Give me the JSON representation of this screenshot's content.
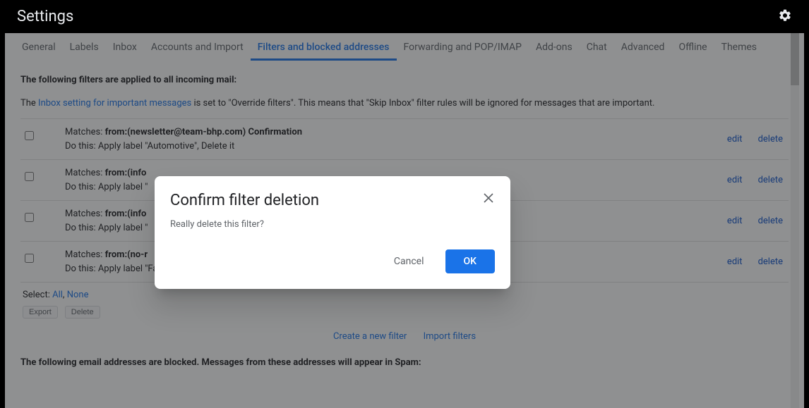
{
  "header": {
    "title": "Settings"
  },
  "tabs": [
    {
      "label": "General",
      "active": false
    },
    {
      "label": "Labels",
      "active": false
    },
    {
      "label": "Inbox",
      "active": false
    },
    {
      "label": "Accounts and Import",
      "active": false
    },
    {
      "label": "Filters and blocked addresses",
      "active": true
    },
    {
      "label": "Forwarding and POP/IMAP",
      "active": false
    },
    {
      "label": "Add-ons",
      "active": false
    },
    {
      "label": "Chat",
      "active": false
    },
    {
      "label": "Advanced",
      "active": false
    },
    {
      "label": "Offline",
      "active": false
    },
    {
      "label": "Themes",
      "active": false
    }
  ],
  "intro": {
    "line1": "The following filters are applied to all incoming mail:",
    "line2_prefix": "The ",
    "line2_link": "Inbox setting for important messages",
    "line2_suffix": " is set to \"Override filters\". This means that \"Skip Inbox\" filter rules will be ignored for messages that are important."
  },
  "filters": [
    {
      "matches_label": "Matches: ",
      "matches_value": "from:(newsletter@team-bhp.com) Confirmation",
      "do_this": "Do this: Apply label \"Automotive\", Delete it",
      "edit": "edit",
      "delete": "delete"
    },
    {
      "matches_label": "Matches: ",
      "matches_value": "from:(info",
      "do_this": "Do this: Apply label \"",
      "edit": "edit",
      "delete": "delete"
    },
    {
      "matches_label": "Matches: ",
      "matches_value": "from:(info",
      "do_this": "Do this: Apply label \"",
      "edit": "edit",
      "delete": "delete"
    },
    {
      "matches_label": "Matches: ",
      "matches_value": "from:(no-r",
      "do_this": "Do this: Apply label \"Fashion\"",
      "edit": "edit",
      "delete": "delete"
    }
  ],
  "select_row": {
    "label": "Select: ",
    "all": "All",
    "sep": ", ",
    "none": "None"
  },
  "buttons": {
    "export": "Export",
    "delete": "Delete"
  },
  "links": {
    "create_filter": "Create a new filter",
    "import_filters": "Import filters"
  },
  "blocked_heading": "The following email addresses are blocked. Messages from these addresses will appear in Spam:",
  "dialog": {
    "title": "Confirm filter deletion",
    "body": "Really delete this filter?",
    "cancel": "Cancel",
    "ok": "OK"
  },
  "colors": {
    "accent": "#1a73e8"
  }
}
